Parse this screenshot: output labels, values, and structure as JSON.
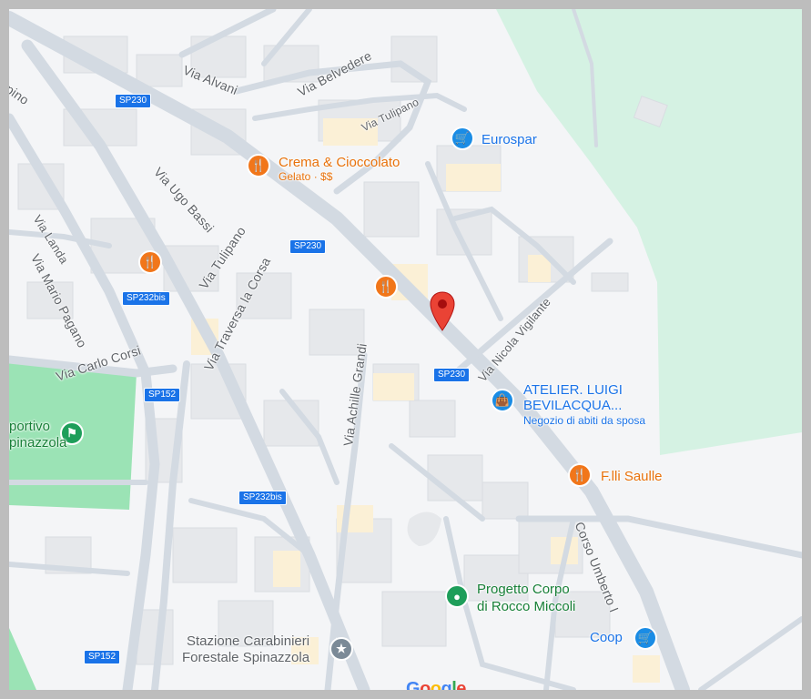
{
  "map": {
    "streets": {
      "via_alvani": "Via Alvani",
      "via_belvedere": "Via Belvedere",
      "via_tulipano_top": "Via Tulipano",
      "via_ugo_bassi": "Via Ugo Bassi",
      "via_tulipano": "Via Tulipano",
      "via_traversa": "Via Traversa la Corsa",
      "via_landa": "Via Landa",
      "via_mario_pagano": "Via Mario Pagano",
      "via_carlo_corsi": "Via Carlo Corsi",
      "via_achille_grandi": "Via Achille Grandi",
      "via_nicola_vigilante": "Via Nicola Vigilante",
      "corso_umberto": "Corso Umberto I",
      "partial_pino": "pino"
    },
    "shields": {
      "sp230_a": "SP230",
      "sp230_b": "SP230",
      "sp230_c": "SP230",
      "sp232bis_a": "SP232bis",
      "sp232bis_b": "SP232bis",
      "sp152_a": "SP152",
      "sp152_b": "SP152"
    },
    "pois": {
      "eurospar": "Eurospar",
      "crema_name": "Crema & Cioccolato",
      "crema_sub": "Gelato · $$",
      "atelier_line1": "ATELIER. LUIGI",
      "atelier_line2": "BEVILACQUA...",
      "atelier_sub": "Negozio di abiti da sposa",
      "saulle": "F.lli Saulle",
      "progetto_line1": "Progetto Corpo",
      "progetto_line2": "di Rocco Miccoli",
      "coop": "Coop",
      "stazione_line1": "Stazione Carabinieri",
      "stazione_line2": "Forestale Spinazzola",
      "sportivo_line1": "portivo",
      "sportivo_line2": "pinazzola"
    },
    "logo": "Google",
    "colors": {
      "road": "#d3dae2",
      "building": "#e8eaed",
      "park": "#d5f2e3",
      "field": "#9be3b5",
      "restaurant": "#f1761a",
      "shop": "#1a8ce5",
      "health": "#1e9e5a",
      "marker": "#ea4335"
    }
  }
}
